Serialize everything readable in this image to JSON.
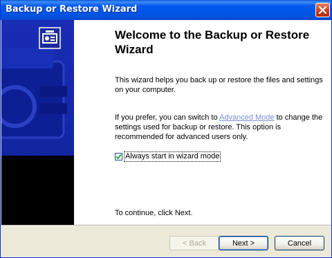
{
  "window": {
    "title": "Backup or Restore Wizard"
  },
  "heading": "Welcome to the Backup or Restore Wizard",
  "intro": "This wizard helps you back up or restore the files and settings on your computer.",
  "advanced": {
    "prefix": "If you prefer, you can switch to ",
    "link": "Advanced Mode",
    "suffix": " to change the settings used for backup or restore. This option is recommended for advanced users only."
  },
  "checkbox": {
    "label": "Always start in wizard mode",
    "checked": true
  },
  "continue_text": "To continue, click Next.",
  "buttons": {
    "back": "< Back",
    "next": "Next >",
    "cancel": "Cancel"
  },
  "colors": {
    "titlebar": "#0055e5",
    "side_panel": "#1226a4",
    "link": "#7b8fd6"
  },
  "icons": {
    "close": "close-icon",
    "wizard": "backup-wizard-icon",
    "check": "checkmark-icon"
  }
}
